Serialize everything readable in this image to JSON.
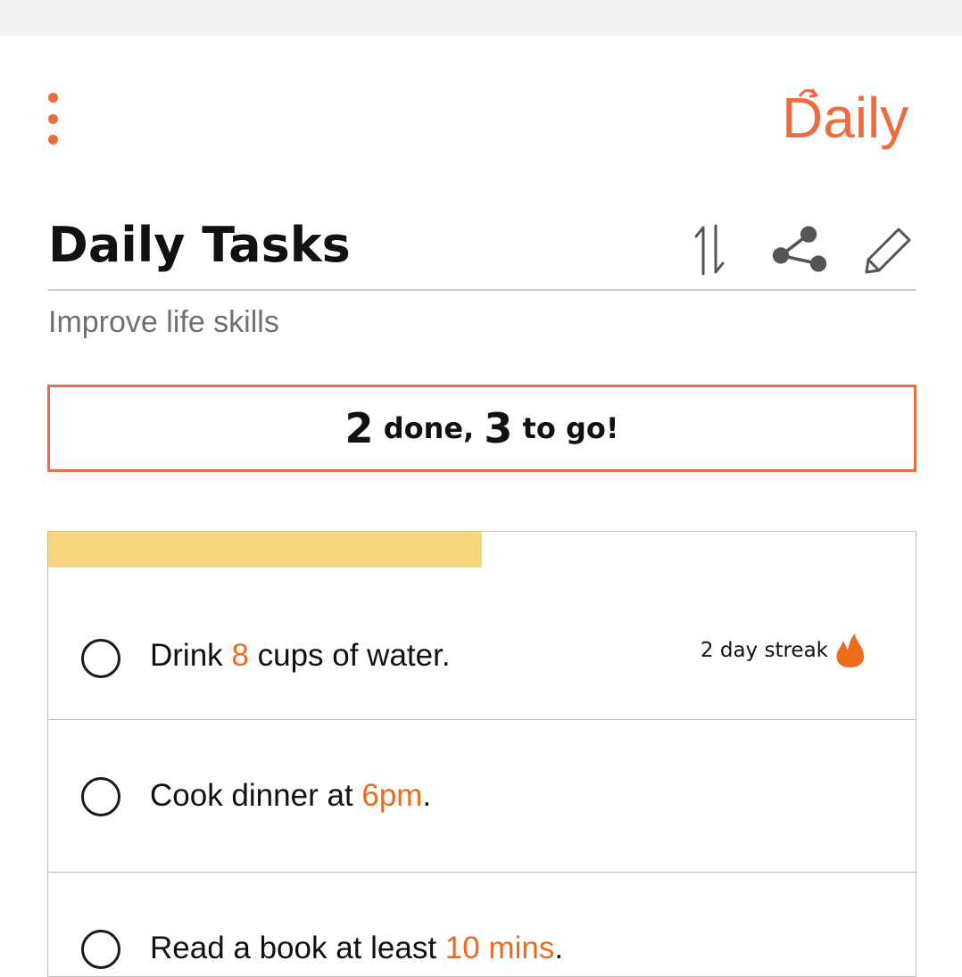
{
  "header": {
    "brand": "Daily",
    "menu_icon": "more-vertical-icon"
  },
  "list": {
    "title": "Daily Tasks",
    "subtitle": "Improve life skills",
    "toolbar": [
      "sort-icon",
      "share-icon",
      "edit-icon"
    ]
  },
  "summary": {
    "done_count": "2",
    "done_label": " done, ",
    "togo_count": "3",
    "togo_label": " to go!"
  },
  "progress": {
    "fraction": 0.5
  },
  "tasks": [
    {
      "pre": "Drink ",
      "hl": "8",
      "post": " cups of water.",
      "streak": "2 day streak",
      "streak_icon": "flame-icon"
    },
    {
      "pre": "Cook dinner at ",
      "hl": "6pm",
      "post": "."
    },
    {
      "pre": "Read a book at least ",
      "hl": "10 mins",
      "post": "."
    }
  ],
  "colors": {
    "accent": "#ee6a3f",
    "highlight": "#ec6b1c",
    "progress": "#f7d77d",
    "divider": "#c9c9c9"
  }
}
